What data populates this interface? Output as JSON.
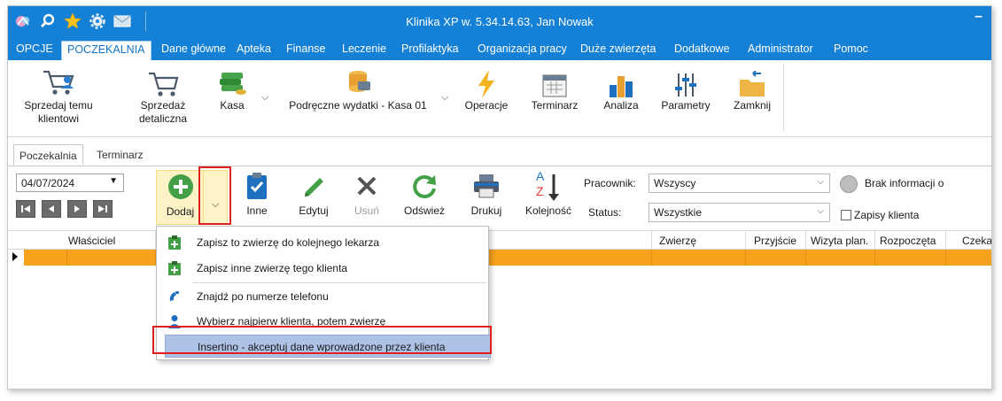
{
  "window": {
    "title": "Klinika XP w. 5.34.14.63, Jan Nowak",
    "minimize_glyph": "–"
  },
  "menu": {
    "tabs": [
      "OPCJE",
      "POCZEKALNIA",
      "Dane główne",
      "Apteka",
      "Finanse",
      "Leczenie",
      "Profilaktyka",
      "Organizacja pracy",
      "Duże zwierzęta",
      "Dodatkowe",
      "Administrator",
      "Pomoc"
    ],
    "active": "POCZEKALNIA"
  },
  "ribbon": {
    "buttons": [
      "Sprzedaj temu klientowi",
      "Sprzedaż detaliczna",
      "Kasa",
      "Podręczne wydatki - Kasa 01",
      "Operacje",
      "Terminarz",
      "Analiza",
      "Parametry",
      "Zamknij"
    ],
    "sprzedaj_line1": "Sprzedaj temu",
    "sprzedaj_line2": "klientowi",
    "sprzedaz_line1": "Sprzedaż",
    "sprzedaz_line2": "detaliczna"
  },
  "subtabs": [
    "Poczekalnia",
    "Terminarz"
  ],
  "toolbar": {
    "date": "04/07/2024",
    "buttons": {
      "dodaj": "Dodaj",
      "inne": "Inne",
      "edytuj": "Edytuj",
      "usun": "Usuń",
      "odswiez": "Odśwież",
      "drukuj": "Drukuj",
      "kolejnosc": "Kolejność"
    },
    "pracownik_label": "Pracownik:",
    "pracownik_value": "Wszyscy",
    "status_label": "Status:",
    "status_value": "Wszystkie",
    "brak_info": "Brak informacji o",
    "zapisy_klienta": "Zapisy klienta",
    "zapisy_checked": false
  },
  "grid": {
    "columns": [
      "Właściciel",
      "Zwierzę",
      "Przyjście",
      "Wizyta plan.",
      "Rozpoczęta",
      "Czeka"
    ]
  },
  "dropdown": {
    "items": [
      "Zapisz to zwierzę do kolejnego lekarza",
      "Zapisz inne zwierzę tego klienta",
      "Znajdź po numerze telefonu",
      "Wybierz najpierw klienta, potem zwierzę",
      "Insertino - akceptuj dane wprowadzone przez klienta"
    ],
    "highlighted_index": 4
  },
  "colors": {
    "titlebar": "#1480d6",
    "accent": "#1173c8",
    "row_highlight": "#f6a21d",
    "menu_highlight": "#aec2e6",
    "annotation_red": "#e02020",
    "dodaj_hover": "#fdf3c6"
  }
}
